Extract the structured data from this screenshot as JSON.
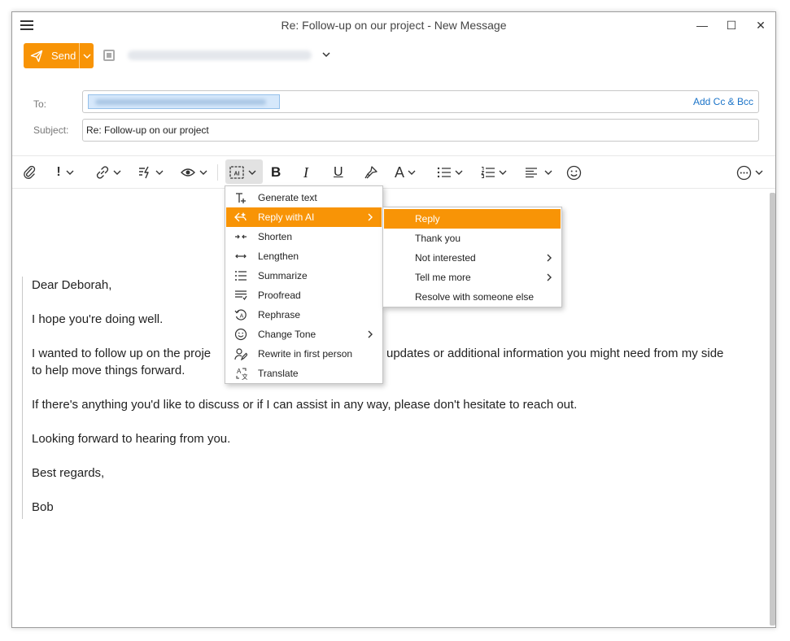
{
  "window": {
    "title": "Re: Follow-up on our project - New Message",
    "minimize_glyph": "—",
    "maximize_glyph": "☐",
    "close_glyph": "✕"
  },
  "send": {
    "label": "Send",
    "icon": "paper-plane-icon"
  },
  "fields": {
    "to_label": "To:",
    "add_cc_bcc": "Add Cc & Bcc",
    "subject_label": "Subject:",
    "subject_value": "Re: Follow-up on our project"
  },
  "toolbar": {
    "icons": [
      "paperclip-icon",
      "importance-icon",
      "link-icon",
      "quick-parts-icon",
      "preview-icon",
      "ai-icon",
      "bold-icon",
      "italic-icon",
      "underline-icon",
      "format-painter-icon",
      "font-icon",
      "bullet-list-icon",
      "numbered-list-icon",
      "align-icon",
      "emoji-icon",
      "more-icon"
    ],
    "bold_glyph": "B",
    "italic_glyph": "I",
    "underline_glyph": "U",
    "font_glyph": "A",
    "importance_glyph": "!"
  },
  "ai_menu": {
    "items": [
      {
        "label": "Generate text",
        "icon": "generate-text-icon"
      },
      {
        "label": "Reply with AI",
        "icon": "reply-ai-icon",
        "has_submenu": true,
        "active": true
      },
      {
        "label": "Shorten",
        "icon": "shorten-icon"
      },
      {
        "label": "Lengthen",
        "icon": "lengthen-icon"
      },
      {
        "label": "Summarize",
        "icon": "summarize-icon"
      },
      {
        "label": "Proofread",
        "icon": "proofread-icon"
      },
      {
        "label": "Rephrase",
        "icon": "rephrase-icon"
      },
      {
        "label": "Change Tone",
        "icon": "change-tone-icon",
        "has_submenu": true
      },
      {
        "label": "Rewrite in first person",
        "icon": "rewrite-icon"
      },
      {
        "label": "Translate",
        "icon": "translate-icon"
      }
    ]
  },
  "reply_submenu": {
    "items": [
      {
        "label": "Reply",
        "active": true
      },
      {
        "label": "Thank you"
      },
      {
        "label": "Not interested",
        "has_submenu": true
      },
      {
        "label": "Tell me more",
        "has_submenu": true
      },
      {
        "label": "Resolve with someone else"
      }
    ]
  },
  "body": {
    "greeting": "Dear Deborah,",
    "p1": "I hope you're doing well.",
    "p2_start": "I wanted to follow up on the proje",
    "p2_end": "updates or additional information you might need from my side",
    "p2_line2": "to help move things forward.",
    "p3": "If there's anything you'd like to discuss or if I can assist in any way, please don't hesitate to reach out.",
    "p4": "Looking forward to hearing from you.",
    "closing": "Best regards,",
    "signature": "Bob"
  },
  "colors": {
    "accent": "#f89406",
    "link": "#1a73c8",
    "chip": "#d6e8fb"
  }
}
